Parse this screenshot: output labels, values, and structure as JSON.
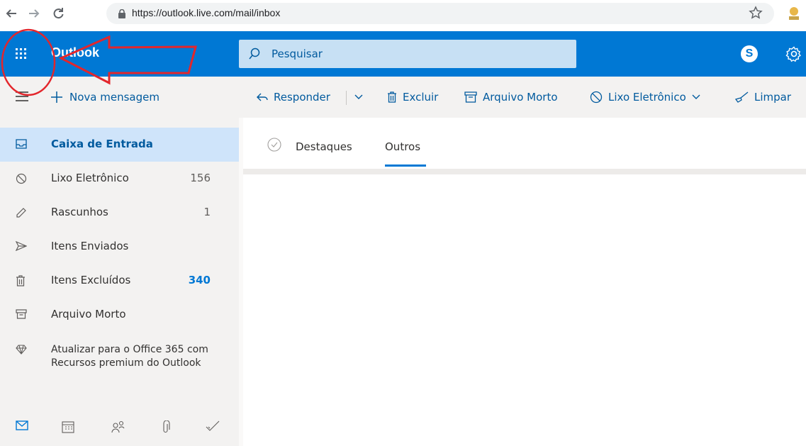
{
  "browser": {
    "url": "https://outlook.live.com/mail/inbox",
    "back_icon": "arrow-left-icon",
    "forward_icon": "arrow-right-icon",
    "reload_icon": "reload-icon"
  },
  "header": {
    "brand": "Outlook",
    "search_placeholder": "Pesquisar",
    "accent": "#0078d4"
  },
  "toolbar": {
    "new_message": "Nova mensagem",
    "reply": "Responder",
    "delete": "Excluir",
    "archive": "Arquivo Morto",
    "junk": "Lixo Eletrônico",
    "sweep": "Limpar"
  },
  "sidebar": {
    "folders": [
      {
        "label": "Caixa de Entrada",
        "count": "",
        "icon": "inbox-icon"
      },
      {
        "label": "Lixo Eletrônico",
        "count": "156",
        "icon": "junk-icon"
      },
      {
        "label": "Rascunhos",
        "count": "1",
        "icon": "pencil-icon"
      },
      {
        "label": "Itens Enviados",
        "count": "",
        "icon": "send-icon"
      },
      {
        "label": "Itens Excluídos",
        "count": "340",
        "icon": "trash-icon"
      },
      {
        "label": "Arquivo Morto",
        "count": "",
        "icon": "archive-icon"
      }
    ],
    "upgrade": "Atualizar para o Office 365 com Recursos premium do Outlook"
  },
  "main": {
    "tabs": [
      {
        "label": "Destaques"
      },
      {
        "label": "Outros"
      }
    ]
  }
}
